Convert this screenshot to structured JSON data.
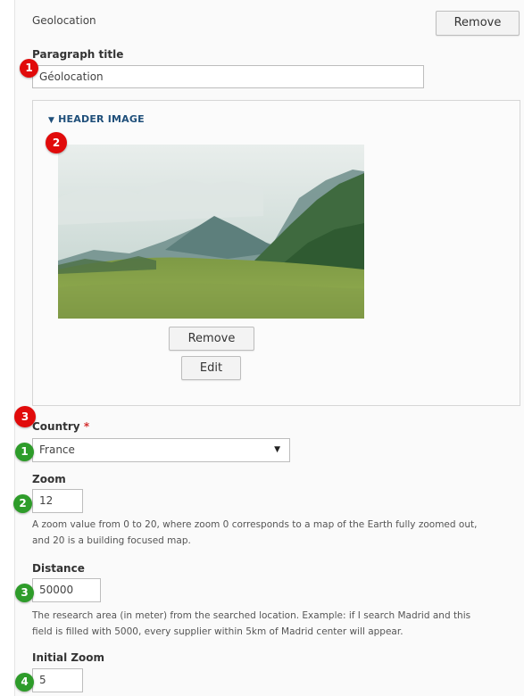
{
  "paragraph": {
    "type_label": "Geolocation",
    "remove_label": "Remove",
    "title_label": "Paragraph title",
    "title_value": "Géolocation"
  },
  "header_image": {
    "summary": "HEADER IMAGE",
    "toggle_glyph": "▼",
    "remove_label": "Remove",
    "edit_label": "Edit"
  },
  "country": {
    "label": "Country",
    "required_mark": "*",
    "value": "France",
    "arrow_glyph": "▼"
  },
  "zoom": {
    "label": "Zoom",
    "value": "12",
    "help_line1": "A zoom value from 0 to 20, where zoom 0 corresponds to a map of the Earth fully zoomed out,",
    "help_line2": "and 20 is a building focused map."
  },
  "distance": {
    "label": "Distance",
    "value": "50000",
    "help_line1": "The research area (in meter) from the searched location.  Example: if I search Madrid and this",
    "help_line2": "field is filled with 5000, every supplier within 5km of Madrid center will appear."
  },
  "initial_zoom": {
    "label": "Initial Zoom",
    "value": "5"
  },
  "badges": {
    "red": [
      "1",
      "2",
      "3"
    ],
    "green": [
      "1",
      "2",
      "3",
      "4"
    ]
  },
  "colors": {
    "badge_red": "#e10b0b",
    "badge_green": "#2e9c2a",
    "summary_link": "#1f4f7a",
    "required": "#d32f2f"
  }
}
